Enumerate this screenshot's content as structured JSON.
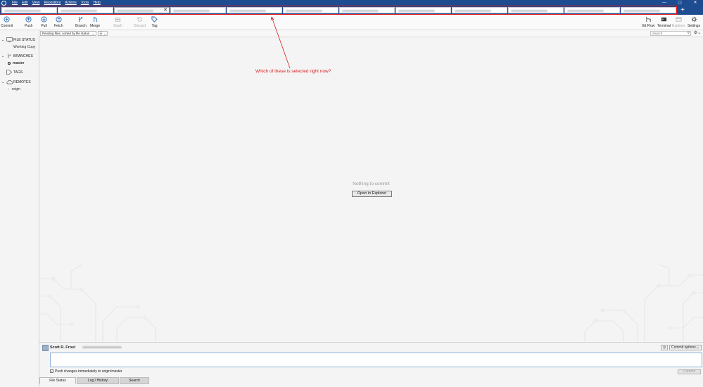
{
  "menu": [
    "File",
    "Edit",
    "View",
    "Repository",
    "Actions",
    "Tools",
    "Help"
  ],
  "window_controls": {
    "minimize": "—",
    "maximize": "▢",
    "close": "✕"
  },
  "tabs": [
    {
      "active": false
    },
    {
      "active": false
    },
    {
      "active": true,
      "close": "✕"
    },
    {
      "active": false
    },
    {
      "active": false
    },
    {
      "active": false
    },
    {
      "active": false
    },
    {
      "active": false
    },
    {
      "active": false
    },
    {
      "active": false
    },
    {
      "active": false
    },
    {
      "active": false
    }
  ],
  "add_tab": "+",
  "toolbar": {
    "commit": "Commit",
    "push": "Push",
    "pull": "Pull",
    "fetch": "Fetch",
    "branch": "Branch",
    "merge": "Merge",
    "stash": "Stash",
    "discard": "Discard",
    "tag": "Tag",
    "git_flow": "Git Flow",
    "terminal": "Terminal",
    "explorer": "Explorer",
    "settings": "Settings"
  },
  "sidebar": {
    "file_status": "FILE STATUS",
    "working_copy": "Working Copy",
    "branches": "BRANCHES",
    "master": "master",
    "tags": "TAGS",
    "remotes": "REMOTES",
    "origin": "origin"
  },
  "subbar": {
    "sort": "Pending files, sorted by file status",
    "search_placeholder": "Search"
  },
  "main": {
    "nothing": "Nothing to commit",
    "open_explorer": "Open in Explorer"
  },
  "annotation": "Which of these is selected right now?",
  "commit": {
    "author": "Scott R. Frost",
    "options": "Commit options...",
    "push_label": "Push changes immediately to origin/master",
    "push_checked": true,
    "button": "Commit"
  },
  "bottom_tabs": [
    "File Status",
    "Log / History",
    "Search"
  ],
  "colors": {
    "titlebar": "#1e4c91",
    "annotation": "#d81b1b",
    "accent_green": "#2ea44f"
  }
}
